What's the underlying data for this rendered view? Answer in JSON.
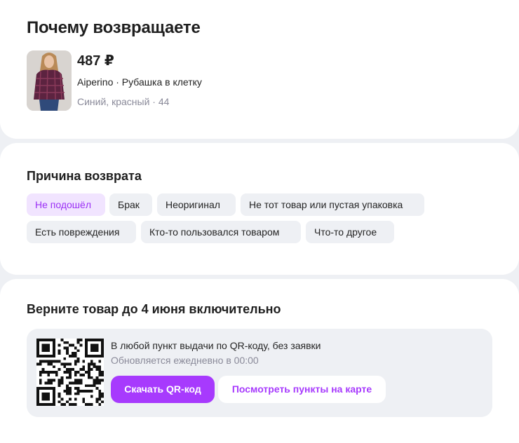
{
  "header": {
    "title": "Почему возвращаете"
  },
  "product": {
    "price": "487 ₽",
    "name": "Aiperino · Рубашка в клетку",
    "variant": "Синий, красный · 44"
  },
  "reason": {
    "title": "Причина возврата",
    "options": [
      {
        "label": "Не подошёл",
        "selected": true
      },
      {
        "label": "Брак",
        "selected": false
      },
      {
        "label": "Неоригинал",
        "selected": false
      },
      {
        "label": "Не тот товар или пустая упаковка",
        "selected": false
      },
      {
        "label": "Есть повреждения",
        "selected": false
      },
      {
        "label": "Кто-то пользовался товаром",
        "selected": false
      },
      {
        "label": "Что-то другое",
        "selected": false
      }
    ]
  },
  "return_info": {
    "title": "Верните товар до 4 июня включительно",
    "qr_text": "В любой пункт выдачи по QR-коду, без заявки",
    "qr_subtext": "Обновляется ежедневно в 00:00",
    "download_button": "Скачать QR-код",
    "map_button": "Посмотреть пункты на карте"
  },
  "colors": {
    "accent": "#a73afd",
    "selected_chip_bg": "#f1e4ff",
    "selected_chip_text": "#9b2ff5",
    "chip_bg": "#eef0f4",
    "muted_text": "#8a8a99"
  }
}
